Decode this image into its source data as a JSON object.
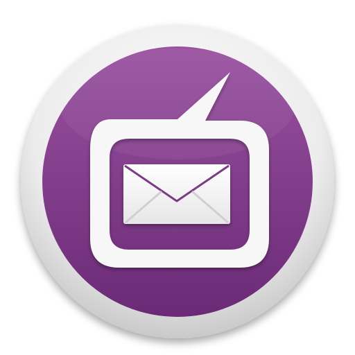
{
  "icon": {
    "name": "message-mail-icon",
    "colors": {
      "ring_light": "#f4f4f4",
      "ring_dark": "#cfcfcf",
      "disc_top": "#974f9d",
      "disc_bottom": "#6e2c79",
      "glyph": "#ffffff",
      "envelope_fold": "#d8d8d8"
    }
  }
}
